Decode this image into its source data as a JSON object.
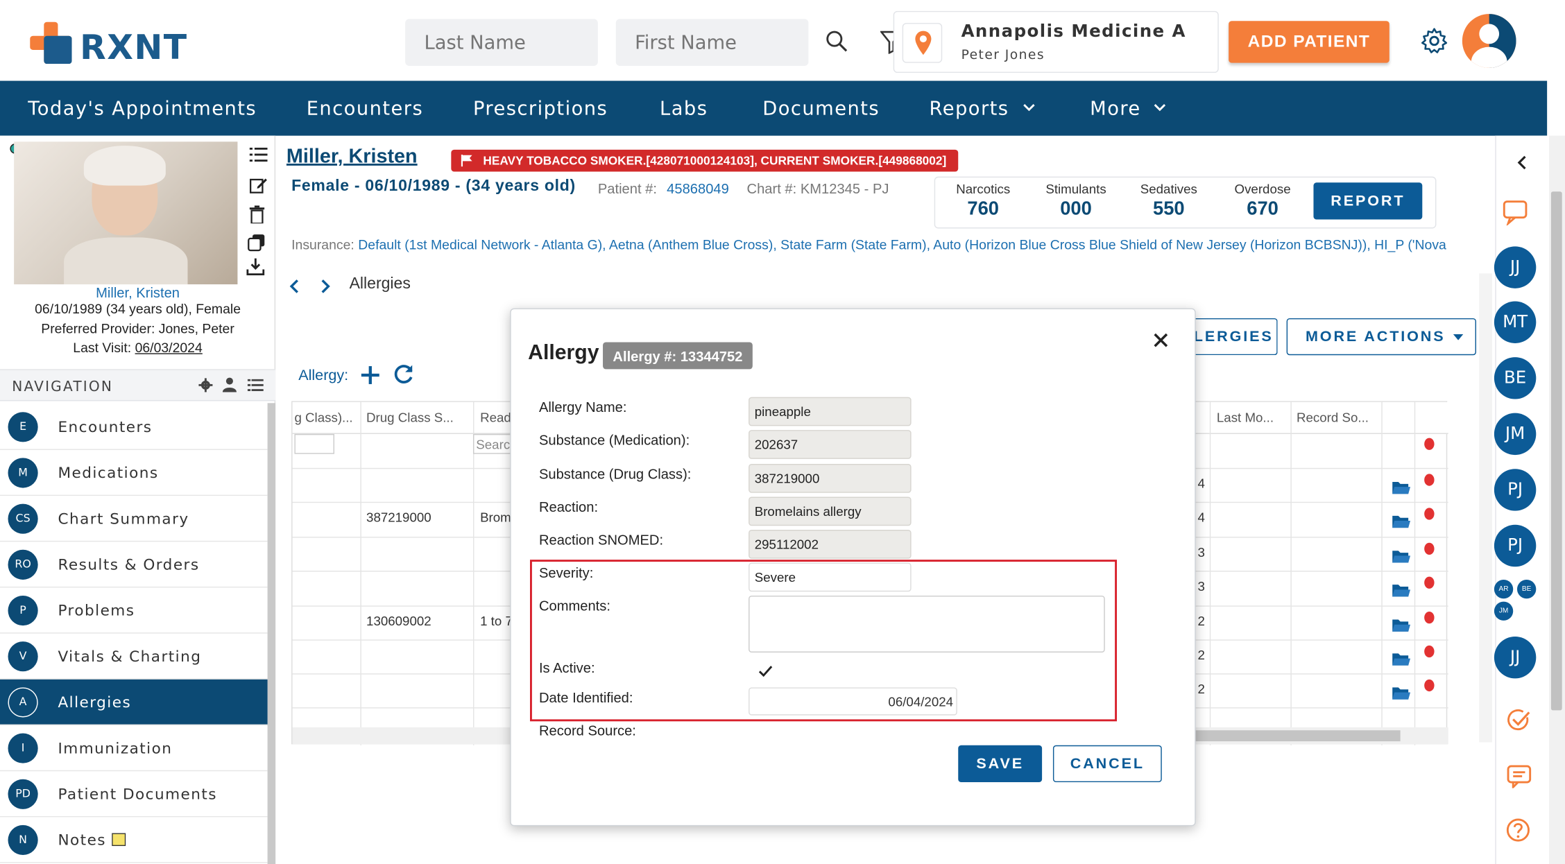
{
  "header": {
    "logo_text": "RXNT",
    "last_name_placeholder": "Last Name",
    "first_name_placeholder": "First Name",
    "location_name": "Annapolis Medicine A",
    "provider_name": "Peter Jones",
    "add_patient_label": "ADD PATIENT"
  },
  "topnav": {
    "items": [
      "Today's Appointments",
      "Encounters",
      "Prescriptions",
      "Labs",
      "Documents",
      "Reports",
      "More"
    ]
  },
  "patient_card": {
    "name": "Miller, Kristen",
    "dob_line": "06/10/1989 (34 years old), Female",
    "preferred_provider_label": "Preferred Provider:",
    "preferred_provider": "Jones, Peter",
    "last_visit_label": "Last Visit:",
    "last_visit": "06/03/2024"
  },
  "navigation": {
    "title": "NAVIGATION",
    "items": [
      {
        "badge": "E",
        "label": "Encounters"
      },
      {
        "badge": "M",
        "label": "Medications"
      },
      {
        "badge": "CS",
        "label": "Chart Summary"
      },
      {
        "badge": "RO",
        "label": "Results & Orders"
      },
      {
        "badge": "P",
        "label": "Problems"
      },
      {
        "badge": "V",
        "label": "Vitals & Charting"
      },
      {
        "badge": "A",
        "label": "Allergies"
      },
      {
        "badge": "I",
        "label": "Immunization"
      },
      {
        "badge": "PD",
        "label": "Patient Documents"
      },
      {
        "badge": "N",
        "label": "Notes"
      }
    ]
  },
  "patient_header": {
    "name": "Miller, Kristen",
    "alert": "HEAVY TOBACCO SMOKER.[428071000124103], CURRENT SMOKER.[449868002]",
    "demographics": "Female - 06/10/1989 - (34 years old)",
    "patient_num_label": "Patient #:",
    "patient_num": "45868049",
    "chart_num_label": "Chart #:",
    "chart_num": "KM12345 - PJ",
    "insurance_label": "Insurance:",
    "insurance": "Default (1st Medical Network - Atlanta G), Aetna (Anthem Blue Cross), State Farm (State Farm), Auto (Horizon Blue Cross Blue Shield of New Jersey (Horizon BCBSNJ)), HI_P ('Nova"
  },
  "stats": {
    "narcotics_label": "Narcotics",
    "narcotics": "760",
    "stimulants_label": "Stimulants",
    "stimulants": "000",
    "sedatives_label": "Sedatives",
    "sedatives": "550",
    "overdose_label": "Overdose",
    "overdose": "670",
    "report_label": "REPORT"
  },
  "section": {
    "title": "Allergies",
    "allergy_label": "Allergy:",
    "allergies_btn": "LERGIES",
    "more_actions_label": "MORE ACTIONS"
  },
  "grid": {
    "columns": [
      "g Class)...",
      "Drug Class S...",
      "Read",
      "Last Mo...",
      "Record So..."
    ],
    "search_placeholder": "Searc",
    "rows": [
      {
        "drug_class": "",
        "reaction": "",
        "right": "4"
      },
      {
        "drug_class": "387219000",
        "reaction": "Brom",
        "right": "4"
      },
      {
        "drug_class": "",
        "reaction": "",
        "right": "3"
      },
      {
        "drug_class": "",
        "reaction": "",
        "right": "3"
      },
      {
        "drug_class": "130609002",
        "reaction": "1 to 7",
        "right": "2"
      },
      {
        "drug_class": "",
        "reaction": "",
        "right": "2"
      },
      {
        "drug_class": "",
        "reaction": "",
        "right": "2"
      }
    ]
  },
  "right_rail": {
    "avatars": [
      "JJ",
      "MT",
      "BE",
      "JM",
      "PJ",
      "PJ"
    ],
    "small_avatars": [
      "AR",
      "BE",
      "JM"
    ],
    "bottom_avatar": "JJ"
  },
  "modal": {
    "title": "Allergy",
    "allergy_number": "Allergy #: 13344752",
    "fields": {
      "allergy_name_label": "Allergy Name:",
      "allergy_name": "pineapple",
      "substance_med_label": "Substance (Medication):",
      "substance_med": "202637",
      "substance_drug_label": "Substance (Drug Class):",
      "substance_drug": "387219000",
      "reaction_label": "Reaction:",
      "reaction": "Bromelains allergy",
      "reaction_snomed_label": "Reaction SNOMED:",
      "reaction_snomed": "295112002",
      "severity_label": "Severity:",
      "severity": "Severe",
      "comments_label": "Comments:",
      "comments": "",
      "is_active_label": "Is Active:",
      "date_identified_label": "Date Identified:",
      "date_identified": "06/04/2024",
      "record_source_label": "Record Source:"
    },
    "save_label": "SAVE",
    "cancel_label": "CANCEL"
  },
  "colors": {
    "primary": "#0c4a74",
    "accent": "#f47e3a",
    "alert": "#d22a2a",
    "highlight": "#d8202c"
  }
}
